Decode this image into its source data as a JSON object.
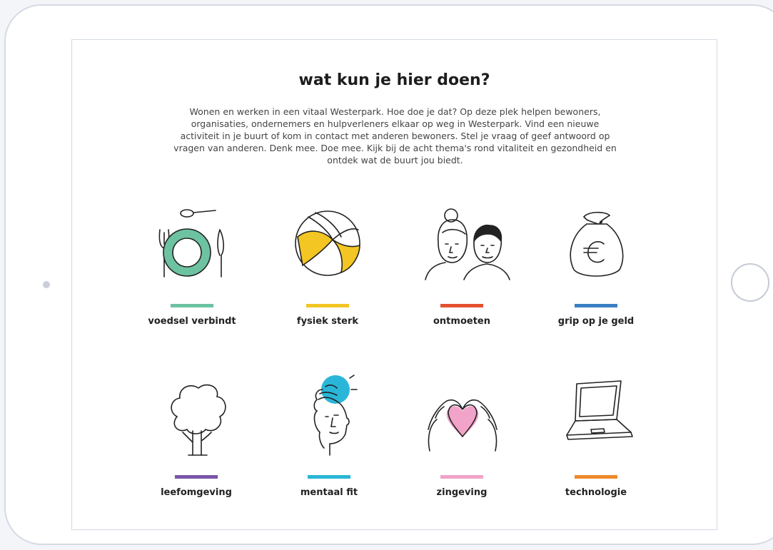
{
  "page": {
    "title": "wat kun je hier doen?",
    "intro": "Wonen en werken in een vitaal Westerpark. Hoe doe je dat? Op deze plek helpen bewoners, organisaties, ondernemers en hulpverleners elkaar op weg in Westerpark. Vind een nieuwe activiteit in je buurt of kom in contact met anderen bewoners. Stel je vraag of geef antwoord op vragen van anderen. Denk mee. Doe mee. Kijk bij de acht thema's rond vitaliteit en gezondheid en ontdek wat de buurt jou biedt."
  },
  "themes": [
    {
      "label": "voedsel verbindt",
      "icon": "plate-cutlery-icon",
      "color": "#6dc3a1"
    },
    {
      "label": "fysiek sterk",
      "icon": "volleyball-icon",
      "color": "#f3c623"
    },
    {
      "label": "ontmoeten",
      "icon": "two-people-icon",
      "color": "#e5502e"
    },
    {
      "label": "grip op je geld",
      "icon": "euro-moneybag-icon",
      "color": "#3a7fc4"
    },
    {
      "label": "leefomgeving",
      "icon": "tree-icon",
      "color": "#7a55a8"
    },
    {
      "label": "mentaal fit",
      "icon": "head-thought-icon",
      "color": "#2ab6d8"
    },
    {
      "label": "zingeving",
      "icon": "heart-hands-icon",
      "color": "#f2a3c9"
    },
    {
      "label": "technologie",
      "icon": "laptop-icon",
      "color": "#ee8a2a"
    }
  ]
}
